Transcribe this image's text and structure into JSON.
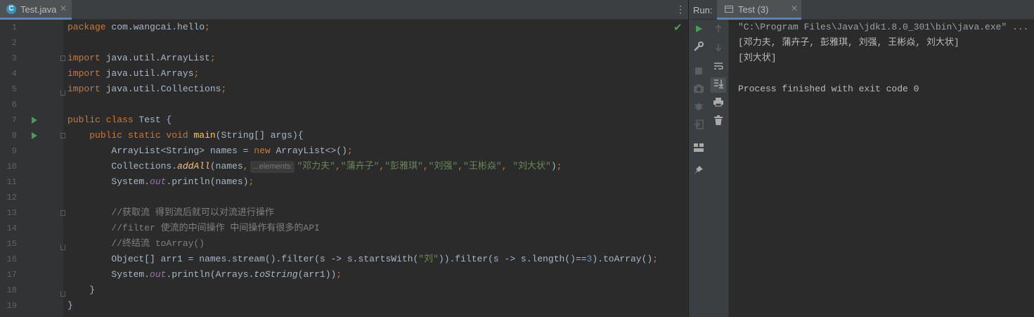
{
  "editor_tab": {
    "icon_letter": "C",
    "file_name": "Test.java",
    "close": "✕"
  },
  "gutter": {
    "line_numbers": [
      "1",
      "2",
      "3",
      "4",
      "5",
      "6",
      "7",
      "8",
      "9",
      "10",
      "11",
      "12",
      "13",
      "14",
      "15",
      "16",
      "17",
      "18",
      "19"
    ]
  },
  "code": {
    "l1": {
      "kw": "package",
      "rest": " com.wangcai.hello",
      "semi": ";"
    },
    "l3": {
      "kw": "import",
      "rest": " java.util.ArrayList",
      "semi": ";"
    },
    "l4": {
      "kw": "import",
      "rest": " java.util.Arrays",
      "semi": ";"
    },
    "l5": {
      "kw": "import",
      "rest": " java.util.Collections",
      "semi": ";"
    },
    "l7": {
      "kw": "public class",
      "name": " Test {"
    },
    "l8": {
      "indent": "    ",
      "kw": "public static void",
      "fn": "main",
      "rest": "(String[] args){"
    },
    "l9": {
      "indent": "        ",
      "a": "ArrayList<String> names = ",
      "kw": "new",
      "b": " ArrayList<>()",
      "semi": ";"
    },
    "l10": {
      "indent": "        ",
      "a": "Collections.",
      "fn": "addAll",
      "b": "(names",
      "comma": ",",
      "hint": "...elements:",
      "s1": "\"邓力夫\"",
      "c1": ",",
      "s2": "\"蒲卉子\"",
      "c2": ",",
      "s3": "\"彭雅琪\"",
      "c3": ",",
      "s4": "\"刘强\"",
      "c4": ",",
      "s5": "\"王彬焱\"",
      "c5": ", ",
      "s6": "\"刘大状\"",
      "end": ")",
      "semi": ";"
    },
    "l11": {
      "indent": "        ",
      "a": "System.",
      "st": "out",
      "b": ".println(names)",
      "semi": ";"
    },
    "l13": {
      "indent": "        ",
      "comment": "//获取流 得到流后就可以对流进行操作"
    },
    "l14": {
      "indent": "        ",
      "comment": "//filter 使流的中间操作 中间操作有很多的API"
    },
    "l15": {
      "indent": "        ",
      "comment": "//终结流 toArray()"
    },
    "l16": {
      "indent": "        ",
      "a": "Object[] arr1 = names.stream().filter(s -> s.startsWith(",
      "s1": "\"刘\"",
      "b": ")).filter(s -> s.length()==",
      "n": "3",
      "c": ").toArray()",
      "semi": ";"
    },
    "l17": {
      "indent": "        ",
      "a": "System.",
      "st": "out",
      "b": ".println(Arrays.",
      "it": "toString",
      "c": "(arr1))",
      "semi": ";"
    },
    "l18": {
      "indent": "    ",
      "text": "}"
    },
    "l19": {
      "text": "}"
    }
  },
  "inspection_check": "✔",
  "kebab": "⋮",
  "run_panel": {
    "label": "Run:",
    "tab_label": "Test (3)",
    "close": "✕",
    "icons": [
      "run-icon",
      "up-arrow-icon",
      "down-arrow-icon",
      "wrench-icon",
      "stop-icon",
      "soft-wrap-icon",
      "camera-icon",
      "scroll-to-end-icon",
      "debug-icon",
      "print-icon",
      "exit-icon",
      "trash-icon",
      "layout-icon",
      "pin-icon"
    ],
    "console": {
      "cmd": "\"C:\\Program Files\\Java\\jdk1.8.0_301\\bin\\java.exe\" ...",
      "out1": "[邓力夫, 蒲卉子, 彭雅琪, 刘强, 王彬焱, 刘大状]",
      "out2": "[刘大状]",
      "exit": "Process finished with exit code 0"
    }
  },
  "colors": {
    "keyword": "#cc7832",
    "method": "#ffc66d",
    "string": "#6a8759",
    "number": "#6897bb",
    "comment": "#808080",
    "static_field": "#9876aa",
    "run_green": "#499c54",
    "tab_accent": "#4a88c7"
  }
}
